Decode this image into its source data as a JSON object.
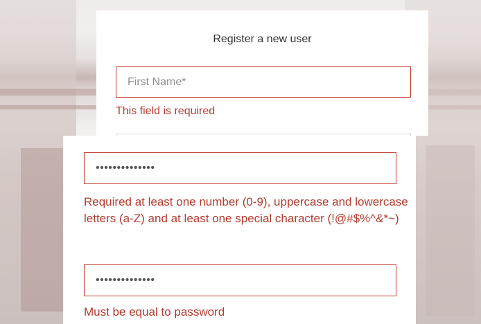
{
  "form": {
    "title": "Register a new user",
    "first_name": {
      "placeholder": "First Name*",
      "error": "This field is required"
    },
    "password": {
      "value": "••••••••••••••",
      "error": "Required at least one number (0-9), uppercase and lowercase letters (a-Z) and at least one special character (!@#$%^&*~)"
    },
    "confirm_password": {
      "value": "••••••••••••••",
      "error": "Must be equal to password"
    }
  },
  "colors": {
    "error": "#b23b2f",
    "field_border": "#c0392b",
    "background": "#ffffff"
  }
}
